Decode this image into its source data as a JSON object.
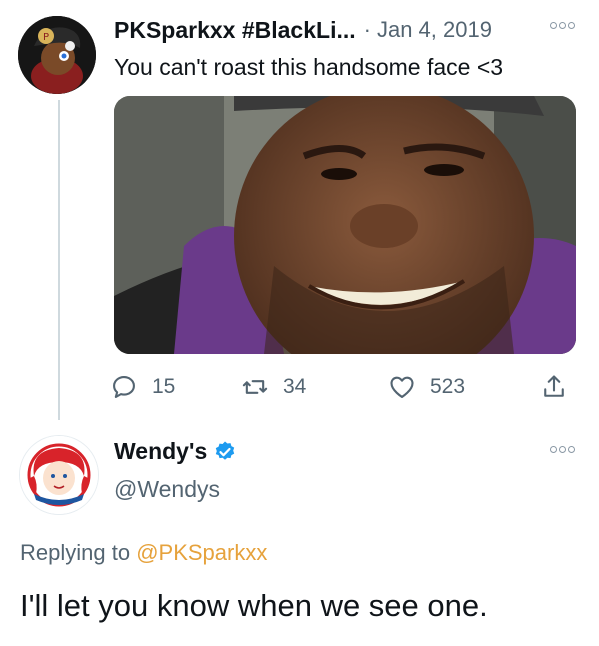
{
  "tweet": {
    "author_name": "PKSparkxx #BlackLi...",
    "separator": "·",
    "date": "Jan 4, 2019",
    "text": "You can't roast this handsome face <3",
    "replies": "15",
    "retweets": "34",
    "likes": "523"
  },
  "reply": {
    "author_name": "Wendy's",
    "handle": "@Wendys",
    "replying_label": "Replying to",
    "replying_mention": "@PKSparkxx",
    "text": "I'll let you know when we see one."
  },
  "colors": {
    "secondary_text": "#536471",
    "mention_text": "#e6a23c",
    "verified_badge": "#1d9bf0",
    "thread_line": "#cfd9de"
  },
  "icons": {
    "reply": "reply-icon",
    "retweet": "retweet-icon",
    "like": "heart-icon",
    "share": "share-icon",
    "more": "more-options-icon",
    "verified": "verified-badge-icon"
  }
}
